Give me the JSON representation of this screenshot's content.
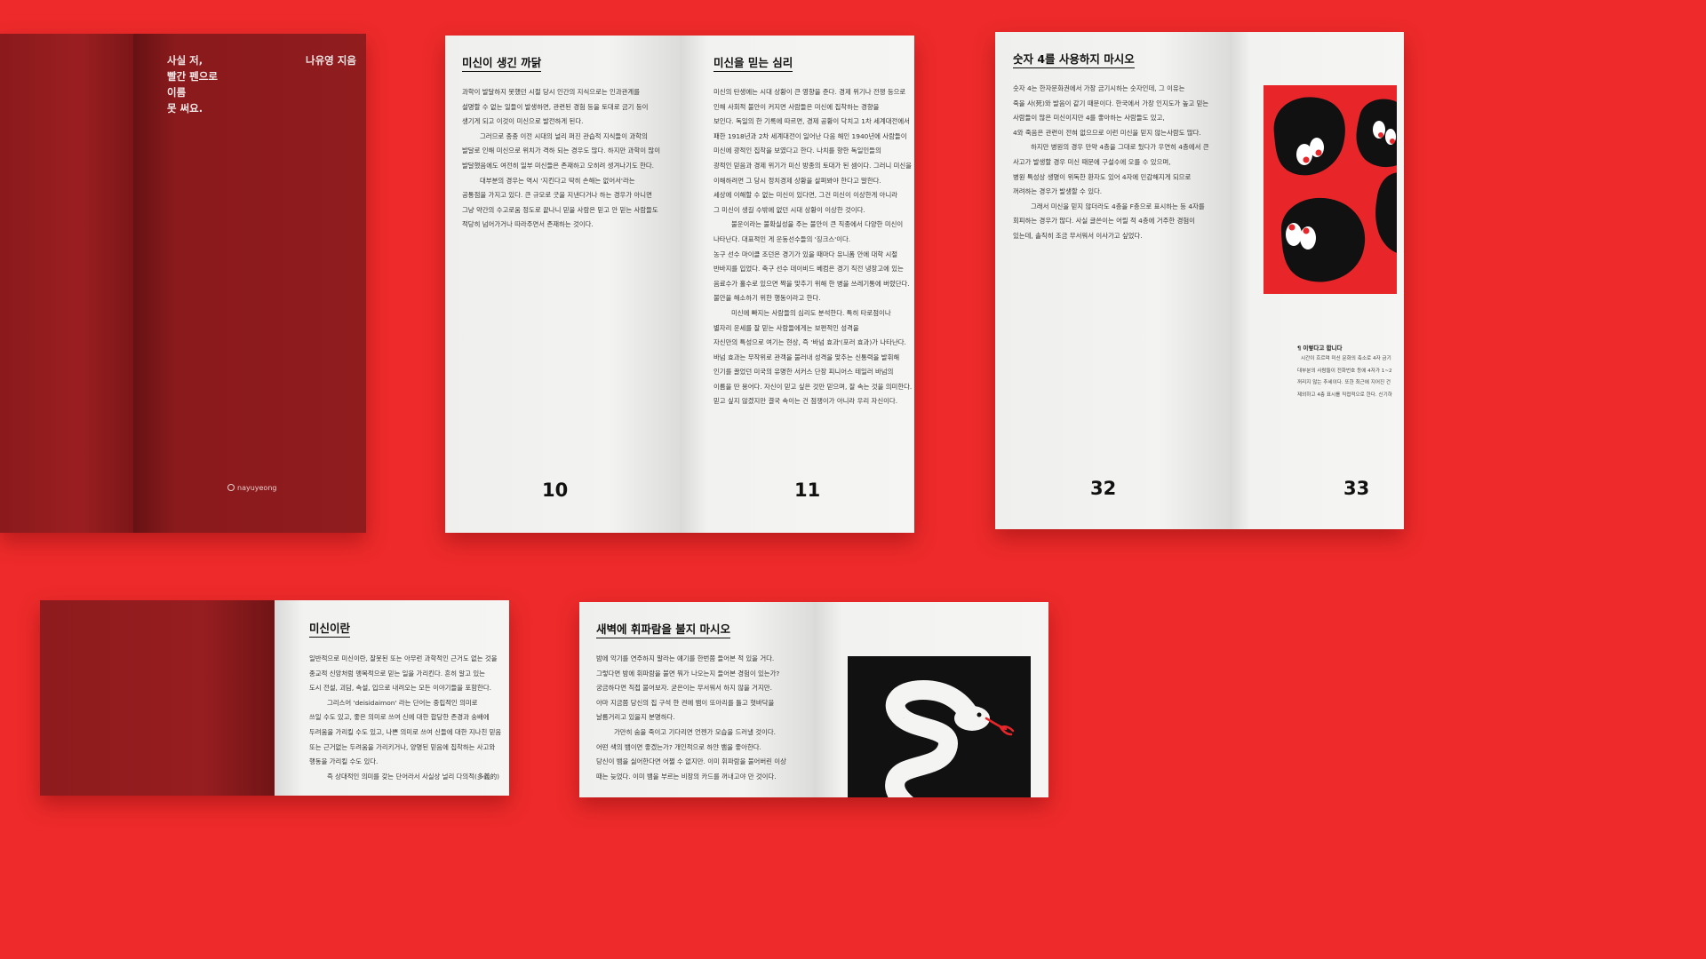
{
  "cover": {
    "title_lines": [
      "사실 저,",
      "빨간 펜으로",
      "이름",
      "못 써요."
    ],
    "author": "나유영 지음",
    "brand": "nayuyeong"
  },
  "spread_10_11": {
    "left_title": "미신이 생긴 까닭",
    "left_lines": [
      "과학이 발달하지 못했던 시절 당시 인간의 지식으로는 인과관계를",
      "설명할 수 없는 일들이 발생하면, 관련된 경험 등을 토대로 금기 등이",
      "생기게 되고 이것이 미신으로 발전하게 된다.",
      "그러므로 종종 이전 시대의 널리 퍼진 관습적 지식들이 과학의",
      "발달로 인해 미신으로 위치가 격하 되는 경우도 많다. 하지만 과학이 많이",
      "발달했음에도 여전히 일부 미신들은 존재하고 오히려 생겨나기도 한다.",
      "대부분의 경우는 역시 '지킨다고 딱히 손해는 없어서'라는",
      "공통점을 가지고 있다. 큰 규모로 굿을 지낸다거나 하는 경우가 아니면",
      "그냥 약간의 수고로움 정도로 끝나니 믿을 사람은 믿고 안 믿는 사람들도",
      "적당히 넘어가거나 따라주면서 존재하는 것이다."
    ],
    "left_page": "10",
    "right_title": "미신을 믿는 심리",
    "right_lines": [
      "미신의 탄생에는 시대 상황이 큰 영향을 준다. 경제 위기나 전쟁 등으로",
      "인해 사회적 불안이 커지면 사람들은 미신에 집착하는 경향을",
      "보인다. 독일의 한 기록에 따르면, 경제 공황이 닥치고 1차 세계대전에서",
      "패한 1918년과 2차 세계대전이 일어난 다음 해인 1940년에 사람들이",
      "미신에 광적인 집착을 보였다고 한다. 나치를 향한 독일인들의",
      "광적인 믿음과 경제 위기가 미신 방종의 토대가 된 셈이다. 그러니 미신을",
      "이해하려면 그 당시 정치경제 상황을 살펴봐야 한다고 말한다.",
      "세상에 이해할 수 없는 미신이 있다면, 그건 미신이 이상한게 아니라",
      "그 미신이 생길 수밖에 없던 시대 상황이 이상한 것이다.",
      "불운이라는 불확실성을 주는 불안이 큰 직종에서 다양한 미신이",
      "나타난다. 대표적인 게 운동선수들의 '징크스'이다.",
      "농구 선수 마이클 조던은 경기가 있을 때마다 유니폼 안에 대학 시절",
      "반바지를 입었다. 축구 선수 데이비드 베컴은 경기 직전 냉장고에 있는",
      "음료수가 홀수로 있으면 짝을 맞추기 위해 한 병을 쓰레기통에 버렸단다.",
      "불안을 해소하기 위한 행동이라고 한다.",
      "미신에 빠지는 사람들의 심리도 분석한다. 특히 타로점이나",
      "별자리 운세를 잘 믿는 사람들에게는 보편적인 성격을",
      "자신만의 특성으로 여기는 현상, 즉 '바넘 효과'(포러 효과)가 나타난다.",
      "바넘 효과는 무작위로 관객을 불러내 성격을 맞추는 신통력을 발휘해",
      "인기를 끌었던 미국의 유명한 서커스 단장 피니어스 테일러 바넘의",
      "이름을 딴 용어다. 자신이 믿고 싶은 것만 믿으며, 잘 속는 것을 의미한다.",
      "믿고 싶지 않겠지만 결국 속이는 건 점쟁이가 아니라 우리 자신이다."
    ],
    "right_page": "11"
  },
  "spread_32_33": {
    "left_title": "숫자 4를 사용하지 마시오",
    "left_lines": [
      "숫자 4는 한자문화권에서 가장 금기시하는 숫자인데, 그 이유는",
      "죽을 사(死)와 발음이 같기 때문이다. 한국에서 가장 인지도가 높고 믿는",
      "사람들이 많은 미신이지만 4를 좋아하는 사람들도 있고,",
      "4와 죽음은 관련이 전혀 없으므로 이런 미신을 믿지 않는사람도 많다.",
      "하지만 병원의 경우 만약 4층을 그대로 뒀다가 우연히 4층에서 큰",
      "사고가 발생할 경우 미신 때문에 구설수에 오를 수 있으며,",
      "병원 특성상 생명이 위독한 환자도 있어 4자에 민감해지게 되므로",
      "꺼려하는 경우가 발생할 수 있다.",
      "그래서 미신을 믿지 않더라도 4층을 F층으로 표시하는 등 4자를",
      "회피하는 경우가 많다. 사실 글쓴이는 어릴 적 4층에 거주한 경험이",
      "있는데, 솔직히 조금 무서워서 이사가고 싶었다."
    ],
    "left_page": "32",
    "right_page": "33",
    "note_title": "¶ 이렇다고 합니다",
    "note_lines": [
      "시간이 흐르며 미신 문화의 축소로 4자 금기",
      "대부분의 사람들이 전화번호 등에 4자가 1~2",
      "꺼리지 않는 추세이다. 또한 최근에 지어진 건",
      "제외하고 4층 표시를 직접적으로 한다. 신기하"
    ]
  },
  "spread_bottom_left": {
    "title": "미신이란",
    "lines": [
      "일반적으로 미신이란, 잘못된 또는 아무런 과학적인 근거도 없는 것을",
      "종교적 신앙처럼 맹목적으로 믿는 일을 가리킨다. 흔히 알고 있는",
      "도시 전설, 괴담, 속설, 입으로 내려오는 모든 이야기들을 포함한다.",
      "그리스어 'deisidaimon' 라는 단어는 중립적인 의미로",
      "쓰일 수도 있고, 좋은 의미로 쓰여 신에 대한 합당한 존경과 숭배에",
      "두려움을 가리킬 수도 있고, 나쁜 의미로 쓰여 신들에 대한 지나친 믿음",
      "또는 근거없는 두려움을 가리키거나, 양명된 믿음에 집착하는 사고와",
      "행동을 가리킬 수도 있다.",
      "즉 상대적인 의미를 갖는 단어라서 사실상 널리 다의적(多義的)"
    ]
  },
  "spread_bottom_right": {
    "title": "새벽에 휘파람을 불지 마시오",
    "lines": [
      "밤에 악기를 연주하지 말라는 얘기를 한번쯤 들어본 적 있을 거다.",
      "그렇다면 밤에 휘파람을 불면 뭐가 나오는지 들어본 경험이 있는가?",
      "궁금하다면 직접 불어보자. 굳은이는 무서워서 하지 않을 거지만.",
      "아마 지금쯤 당신의 집 구석 한 켠에 뱀이 또아리를 틀고 혓바닥을",
      "날름거리고 있을지 분명하다.",
      "가만히 숨을 죽이고 기다리면 언젠가 모습을 드러낼 것이다.",
      "어떤 색의 뱀이면 좋겠는가? 개인적으로 하얀 뱀을 좋아한다.",
      "당신이 뱀을 싫어한다면 어쩔 수 없지만. 이미 휘파람을 불어버린 이상",
      "때는 늦었다. 이미 뱀을 부르는 비장의 카드를 꺼내고야 만 것이다."
    ]
  },
  "colors": {
    "background": "#ee2a2a",
    "cover": "#8a1a1c",
    "paper": "#f4f4f2",
    "illustration_black": "#111111"
  }
}
